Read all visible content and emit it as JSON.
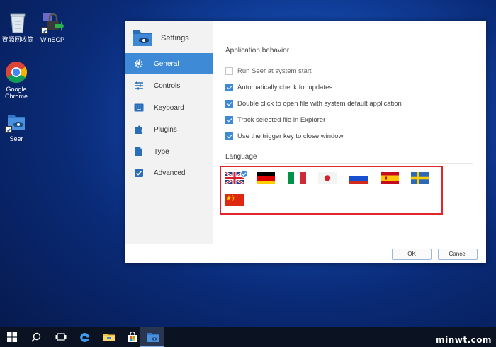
{
  "desktop": {
    "icons": [
      {
        "label": "資源回收筒",
        "icon": "recycle-bin-icon"
      },
      {
        "label": "WinSCP",
        "icon": "winscp-icon"
      },
      {
        "label": "Google Chrome",
        "icon": "chrome-icon"
      },
      {
        "label": "Seer",
        "icon": "seer-icon"
      }
    ]
  },
  "dialog": {
    "app_title": "Settings",
    "nav": [
      {
        "label": "General",
        "icon": "gear-icon",
        "active": true
      },
      {
        "label": "Controls",
        "icon": "sliders-icon"
      },
      {
        "label": "Keyboard",
        "icon": "keyboard-icon"
      },
      {
        "label": "Plugins",
        "icon": "puzzle-icon"
      },
      {
        "label": "Type",
        "icon": "type-icon"
      },
      {
        "label": "Advanced",
        "icon": "checkbox-icon"
      }
    ],
    "behavior_title": "Application behavior",
    "options": [
      {
        "label": "Run Seer at system start",
        "checked": false
      },
      {
        "label": "Automatically check for updates",
        "checked": true
      },
      {
        "label": "Double click to open file with system default application",
        "checked": true
      },
      {
        "label": "Track selected file in Explorer",
        "checked": true
      },
      {
        "label": "Use the trigger key to close window",
        "checked": true
      }
    ],
    "language_title": "Language",
    "languages": [
      {
        "flag": "uk-flag",
        "selected": true
      },
      {
        "flag": "germany-flag"
      },
      {
        "flag": "italy-flag"
      },
      {
        "flag": "japan-flag"
      },
      {
        "flag": "russia-flag"
      },
      {
        "flag": "spain-flag"
      },
      {
        "flag": "sweden-flag"
      },
      {
        "flag": "china-flag"
      }
    ],
    "ok_label": "OK",
    "cancel_label": "Cancel"
  },
  "taskbar": {
    "items": [
      "windows-start-icon",
      "search-icon",
      "task-view-icon",
      "edge-icon",
      "file-explorer-icon",
      "store-icon",
      "seer-icon"
    ]
  },
  "watermark": "minwt.com",
  "colors": {
    "accent": "#3e8ad6",
    "highlight_box": "#e2252a"
  }
}
